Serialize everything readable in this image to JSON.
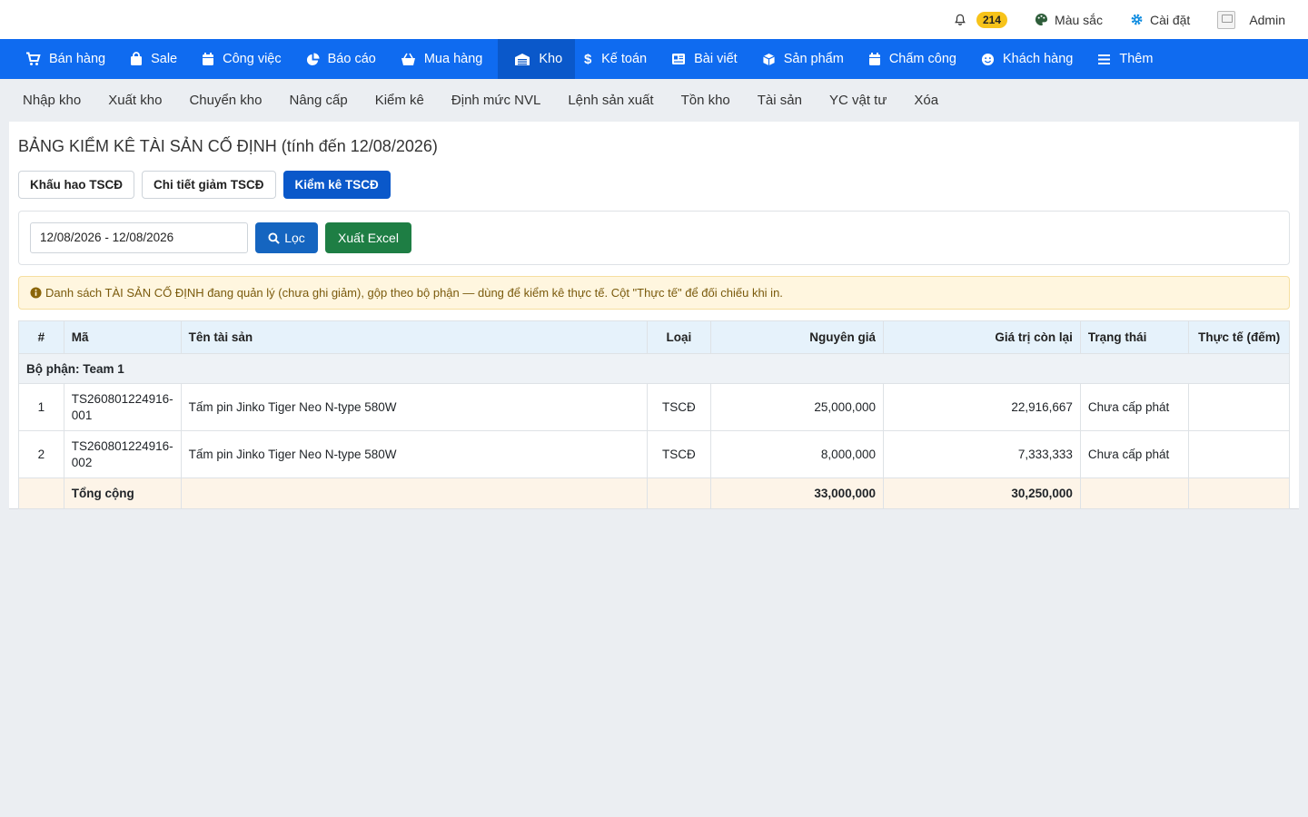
{
  "topbar": {
    "notification_count": "214",
    "colors_label": "Màu sắc",
    "settings_label": "Cài đặt",
    "user_name": "Admin"
  },
  "main_nav": [
    {
      "label": "Bán hàng",
      "icon": "cart-icon"
    },
    {
      "label": "Sale",
      "icon": "bag-icon"
    },
    {
      "label": "Công việc",
      "icon": "calendar-icon"
    },
    {
      "label": "Báo cáo",
      "icon": "pie-chart-icon"
    },
    {
      "label": "Mua hàng",
      "icon": "basket-icon"
    },
    {
      "label": "Kho",
      "icon": "warehouse-icon",
      "active": true
    },
    {
      "label": "Kế toán",
      "icon": "dollar-icon"
    },
    {
      "label": "Bài viết",
      "icon": "newspaper-icon"
    },
    {
      "label": "Sản phẩm",
      "icon": "box-icon"
    },
    {
      "label": "Chấm công",
      "icon": "calendar-icon"
    },
    {
      "label": "Khách hàng",
      "icon": "smile-icon"
    },
    {
      "label": "Thêm",
      "icon": "menu-icon"
    }
  ],
  "sub_nav": [
    "Nhập kho",
    "Xuất kho",
    "Chuyển kho",
    "Nâng cấp",
    "Kiểm kê",
    "Định mức NVL",
    "Lệnh sản xuất",
    "Tồn kho",
    "Tài sản",
    "YC vật tư",
    "Xóa"
  ],
  "page": {
    "title": "BẢNG KIỂM KÊ TÀI SẢN CỐ ĐỊNH (tính đến 12/08/2026)",
    "tabs": [
      {
        "label": "Khấu hao TSCĐ",
        "active": false
      },
      {
        "label": "Chi tiết giảm TSCĐ",
        "active": false
      },
      {
        "label": "Kiểm kê TSCĐ",
        "active": true
      }
    ],
    "filter": {
      "date_range": "12/08/2026 - 12/08/2026",
      "filter_button": "Lọc",
      "export_button": "Xuất Excel"
    },
    "alert": "Danh sách TÀI SẢN CỐ ĐỊNH đang quản lý (chưa ghi giảm), gộp theo bộ phận — dùng để kiểm kê thực tế. Cột \"Thực tế\" để đối chiếu khi in."
  },
  "table": {
    "headers": [
      "#",
      "Mã",
      "Tên tài sản",
      "Loại",
      "Nguyên giá",
      "Giá trị còn lại",
      "Trạng thái",
      "Thực tế (đếm)"
    ],
    "group_label": "Bộ phận: Team 1",
    "rows": [
      {
        "no": "1",
        "code_1": "TS260801224916-",
        "code_2": "001",
        "name": "Tấm pin Jinko Tiger Neo N-type 580W",
        "type": "TSCĐ",
        "original": "25,000,000",
        "remaining": "22,916,667",
        "status": "Chưa cấp phát",
        "actual": ""
      },
      {
        "no": "2",
        "code_1": "TS260801224916-",
        "code_2": "002",
        "name": "Tấm pin Jinko Tiger Neo N-type 580W",
        "type": "TSCĐ",
        "original": "8,000,000",
        "remaining": "7,333,333",
        "status": "Chưa cấp phát",
        "actual": ""
      }
    ],
    "total": {
      "label": "Tổng cộng",
      "original": "33,000,000",
      "remaining": "30,250,000"
    }
  }
}
